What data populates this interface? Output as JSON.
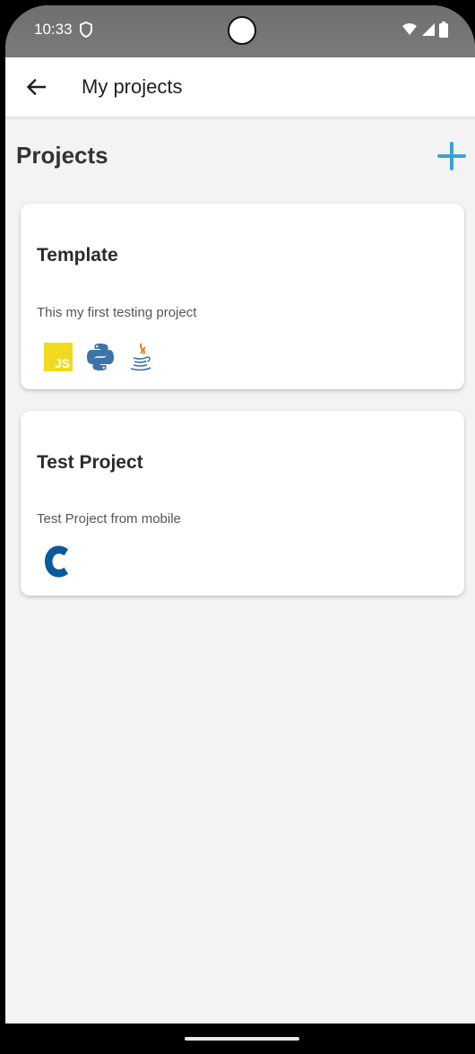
{
  "status_bar": {
    "time": "10:33"
  },
  "app_bar": {
    "title": "My projects"
  },
  "section": {
    "title": "Projects"
  },
  "projects": [
    {
      "title": "Template",
      "description": "This my first testing project",
      "languages": [
        "javascript-icon",
        "python-icon",
        "java-icon"
      ],
      "js_label": "JS"
    },
    {
      "title": "Test Project",
      "description": "Test Project from mobile",
      "languages": [
        "c-icon"
      ]
    }
  ],
  "colors": {
    "accent": "#3aa3d6",
    "js_yellow": "#f0db1e",
    "python_blue": "#3d73a8",
    "c_blue": "#0b5a9c"
  }
}
